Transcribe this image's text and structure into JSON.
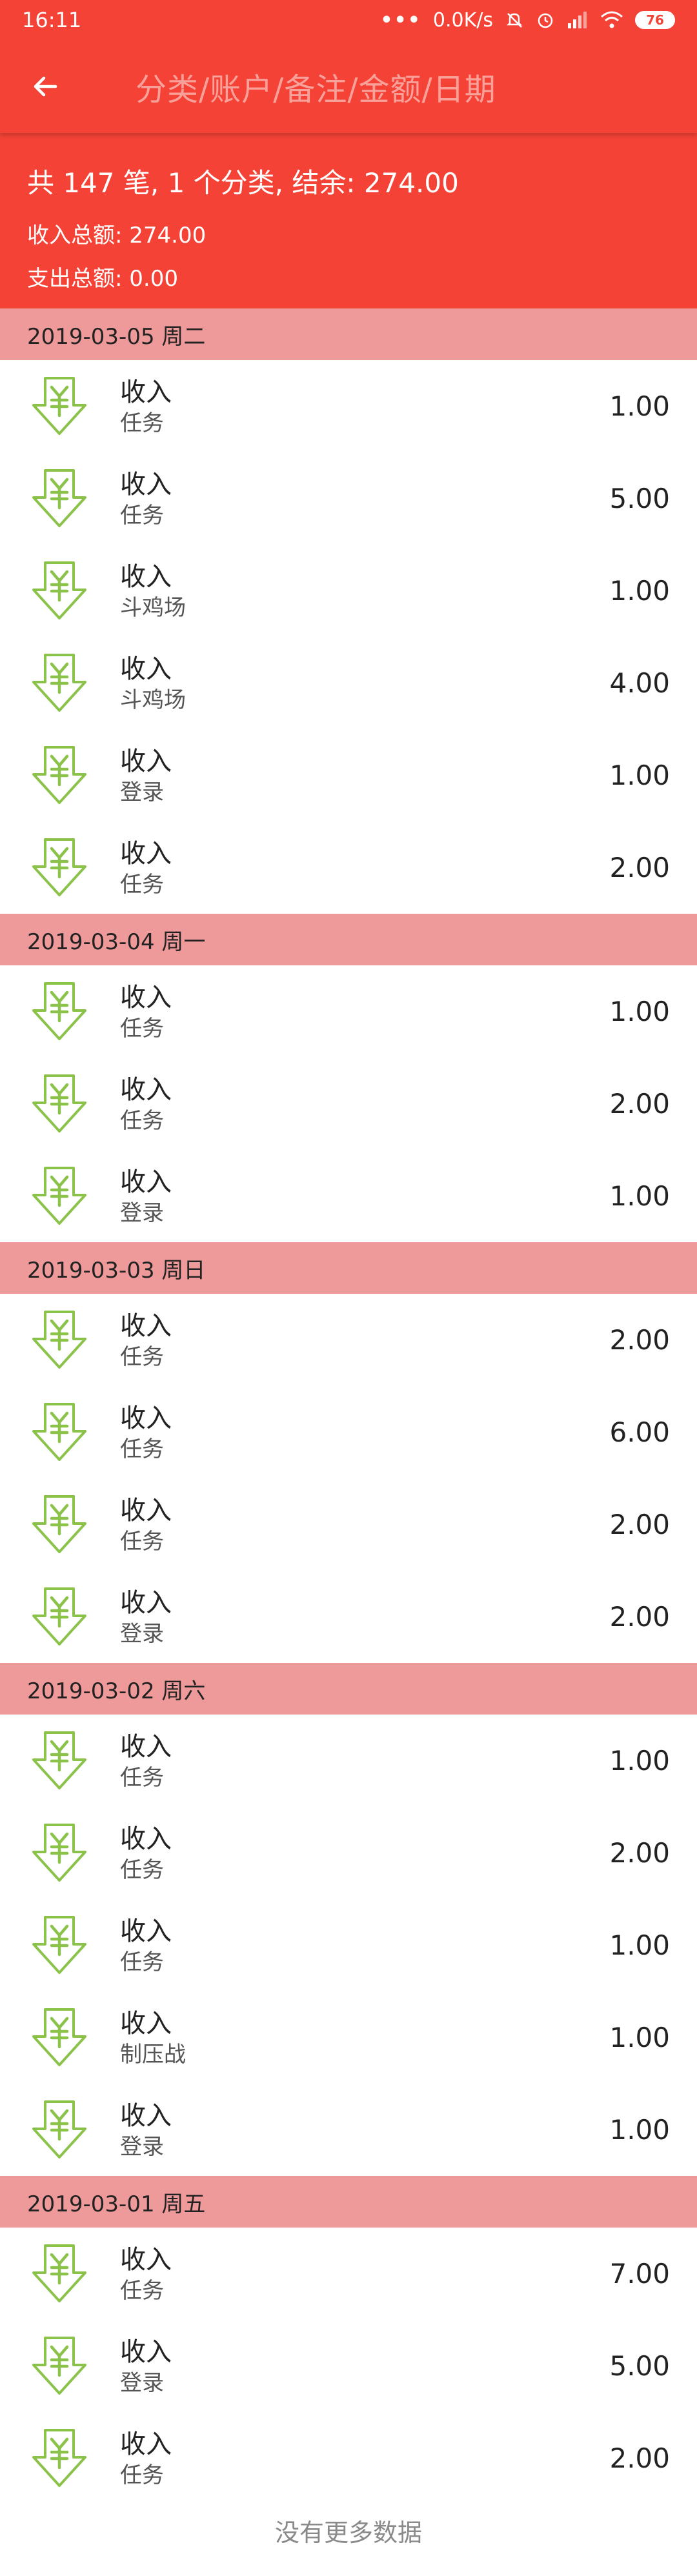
{
  "status_bar": {
    "time": "16:11",
    "net_speed": "0.0K/s",
    "battery": "76"
  },
  "toolbar": {
    "title": "分类/账户/备注/金额/日期"
  },
  "summary": {
    "headline": "共 147 笔, 1 个分类, 结余: 274.00",
    "income_total": "收入总额: 274.00",
    "expense_total": "支出总额: 0.00"
  },
  "groups": [
    {
      "date": "2019-03-05 周二",
      "items": [
        {
          "title": "收入",
          "sub": "任务",
          "amount": "1.00"
        },
        {
          "title": "收入",
          "sub": "任务",
          "amount": "5.00"
        },
        {
          "title": "收入",
          "sub": "斗鸡场",
          "amount": "1.00"
        },
        {
          "title": "收入",
          "sub": "斗鸡场",
          "amount": "4.00"
        },
        {
          "title": "收入",
          "sub": "登录",
          "amount": "1.00"
        },
        {
          "title": "收入",
          "sub": "任务",
          "amount": "2.00"
        }
      ]
    },
    {
      "date": "2019-03-04 周一",
      "items": [
        {
          "title": "收入",
          "sub": "任务",
          "amount": "1.00"
        },
        {
          "title": "收入",
          "sub": "任务",
          "amount": "2.00"
        },
        {
          "title": "收入",
          "sub": "登录",
          "amount": "1.00"
        }
      ]
    },
    {
      "date": "2019-03-03 周日",
      "items": [
        {
          "title": "收入",
          "sub": "任务",
          "amount": "2.00"
        },
        {
          "title": "收入",
          "sub": "任务",
          "amount": "6.00"
        },
        {
          "title": "收入",
          "sub": "任务",
          "amount": "2.00"
        },
        {
          "title": "收入",
          "sub": "登录",
          "amount": "2.00"
        }
      ]
    },
    {
      "date": "2019-03-02 周六",
      "items": [
        {
          "title": "收入",
          "sub": "任务",
          "amount": "1.00"
        },
        {
          "title": "收入",
          "sub": "任务",
          "amount": "2.00"
        },
        {
          "title": "收入",
          "sub": "任务",
          "amount": "1.00"
        },
        {
          "title": "收入",
          "sub": "制压战",
          "amount": "1.00"
        },
        {
          "title": "收入",
          "sub": "登录",
          "amount": "1.00"
        }
      ]
    },
    {
      "date": "2019-03-01 周五",
      "items": [
        {
          "title": "收入",
          "sub": "任务",
          "amount": "7.00"
        },
        {
          "title": "收入",
          "sub": "登录",
          "amount": "5.00"
        },
        {
          "title": "收入",
          "sub": "任务",
          "amount": "2.00"
        }
      ]
    }
  ],
  "footer": {
    "text": "没有更多数据"
  },
  "colors": {
    "primary": "#f44336",
    "group_header": "#ef9a9a",
    "income_icon": "#8bc34a"
  }
}
